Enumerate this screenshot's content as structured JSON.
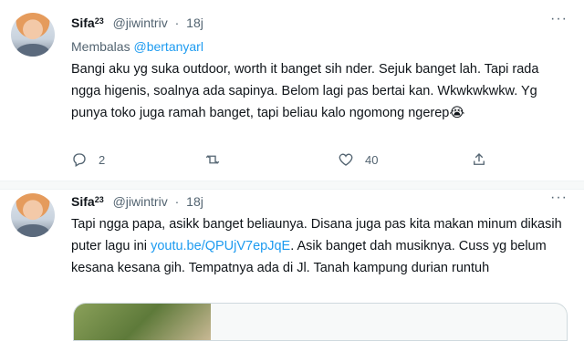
{
  "tweets": [
    {
      "name": "Sifa",
      "name_sup": "23",
      "handle": "@jiwintriv",
      "separator": "·",
      "time": "18j",
      "reply_prefix": "Membalas",
      "reply_to": "@bertanyarl",
      "text": "Bangi aku yg suka outdoor, worth it banget sih nder. Sejuk banget lah. Tapi rada ngga higenis, soalnya ada sapinya. Belom lagi pas bertai kan. Wkwkwkwkw. Yg punya toko juga ramah banget, tapi beliau kalo ngomong ngerep😭",
      "actions": {
        "reply_count": "2",
        "retweet_count": "",
        "like_count": "40"
      }
    },
    {
      "name": "Sifa",
      "name_sup": "23",
      "handle": "@jiwintriv",
      "separator": "·",
      "time": "18j",
      "text_part1": "Tapi ngga papa, asikk banget beliaunya. Disana juga pas kita makan minum dikasih puter lagu ini ",
      "link": "youtu.be/QPUjV7epJqE",
      "text_part2": ". Asik banget dah musiknya. Cuss yg belum kesana kesana gih. Tempatnya ada di Jl. Tanah kampung durian runtuh"
    }
  ],
  "more_label": "···",
  "icons": [
    "avatar",
    "more-icon",
    "reply-icon",
    "retweet-icon",
    "like-icon",
    "share-icon"
  ],
  "colors": {
    "accent": "#1d9bf0",
    "secondary_text": "#536471",
    "text": "#0f1419"
  }
}
